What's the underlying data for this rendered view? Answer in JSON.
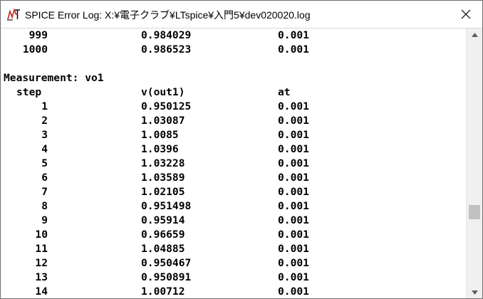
{
  "window": {
    "title": "SPICE Error Log: X:¥電子クラブ¥LTspice¥入門5¥dev020020.log"
  },
  "icons": {
    "app": "ltspice-icon",
    "close": "close-icon",
    "scroll_up": "arrow-up-icon",
    "scroll_down": "arrow-down-icon"
  },
  "log": {
    "prev_rows": [
      {
        "step": "999",
        "value": "0.984029",
        "at": "0.001"
      },
      {
        "step": "1000",
        "value": "0.986523",
        "at": "0.001"
      }
    ],
    "measurement_title": "Measurement: vo1",
    "headers": {
      "step": "step",
      "value": "v(out1)",
      "at": "at"
    },
    "rows": [
      {
        "step": "1",
        "value": "0.950125",
        "at": "0.001"
      },
      {
        "step": "2",
        "value": "1.03087",
        "at": "0.001"
      },
      {
        "step": "3",
        "value": "1.0085",
        "at": "0.001"
      },
      {
        "step": "4",
        "value": "1.0396",
        "at": "0.001"
      },
      {
        "step": "5",
        "value": "1.03228",
        "at": "0.001"
      },
      {
        "step": "6",
        "value": "1.03589",
        "at": "0.001"
      },
      {
        "step": "7",
        "value": "1.02105",
        "at": "0.001"
      },
      {
        "step": "8",
        "value": "0.951498",
        "at": "0.001"
      },
      {
        "step": "9",
        "value": "0.95914",
        "at": "0.001"
      },
      {
        "step": "10",
        "value": "0.96659",
        "at": "0.001"
      },
      {
        "step": "11",
        "value": "1.04885",
        "at": "0.001"
      },
      {
        "step": "12",
        "value": "0.950467",
        "at": "0.001"
      },
      {
        "step": "13",
        "value": "0.950891",
        "at": "0.001"
      },
      {
        "step": "14",
        "value": "1.00712",
        "at": "0.001"
      }
    ]
  },
  "scroll": {
    "position": 0.71
  }
}
